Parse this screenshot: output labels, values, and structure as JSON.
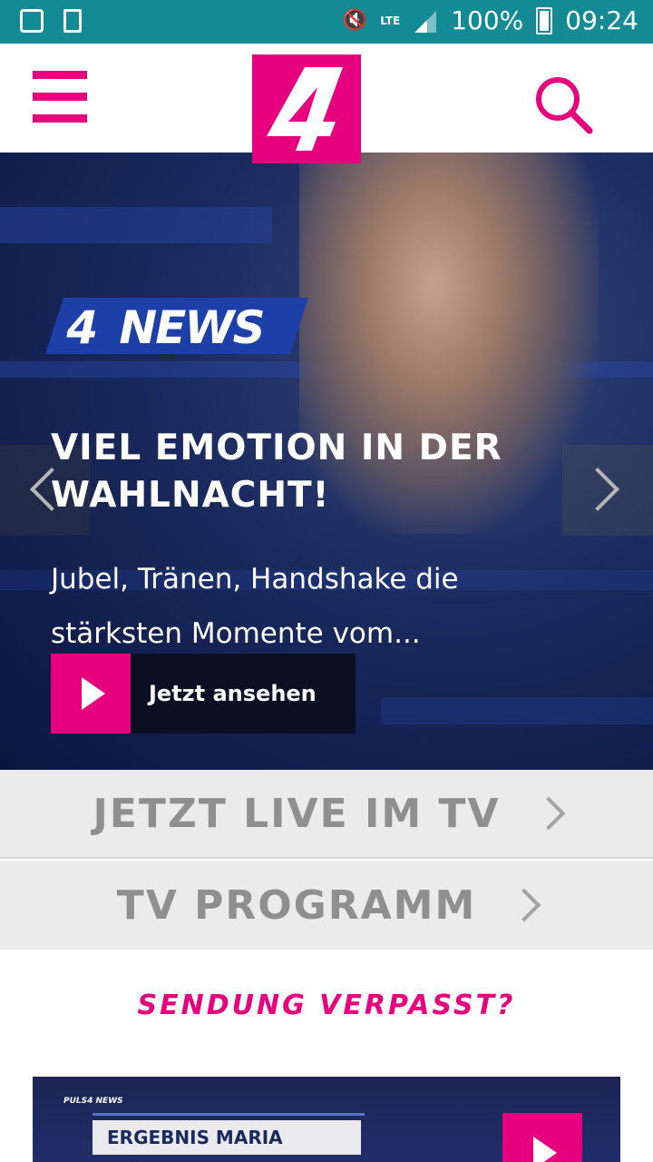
{
  "status_bar": {
    "battery": "100%",
    "time": "09:24",
    "network": "LTE",
    "icons": [
      "image-icon",
      "tablet-check-icon",
      "vibrate-mute-icon",
      "signal-icon",
      "battery-icon"
    ]
  },
  "header": {
    "logo_text": "4",
    "menu_icon": "hamburger-icon",
    "search_icon": "search-icon"
  },
  "hero": {
    "brand_badge": "NEWS",
    "brand_badge_number": "4",
    "title": "VIEL EMOTION IN DER WAHLNACHT!",
    "subtitle": "Jubel, Tränen, Handshake die stärksten Momente vom...",
    "cta_label": "Jetzt ansehen",
    "prev_icon": "chevron-left-icon",
    "next_icon": "chevron-right-icon"
  },
  "links": {
    "live_label": "JETZT LIVE IM TV",
    "program_label": "TV PROGRAMM"
  },
  "missed": {
    "title": "SENDUNG VERPASST?",
    "thumb_brand": "PULS4 NEWS",
    "thumb_caption": "ERGEBNIS MARIA WÖRTH"
  },
  "colors": {
    "accent": "#e6007e",
    "status_bar": "#128b94",
    "row_bg": "#ecebeb"
  }
}
